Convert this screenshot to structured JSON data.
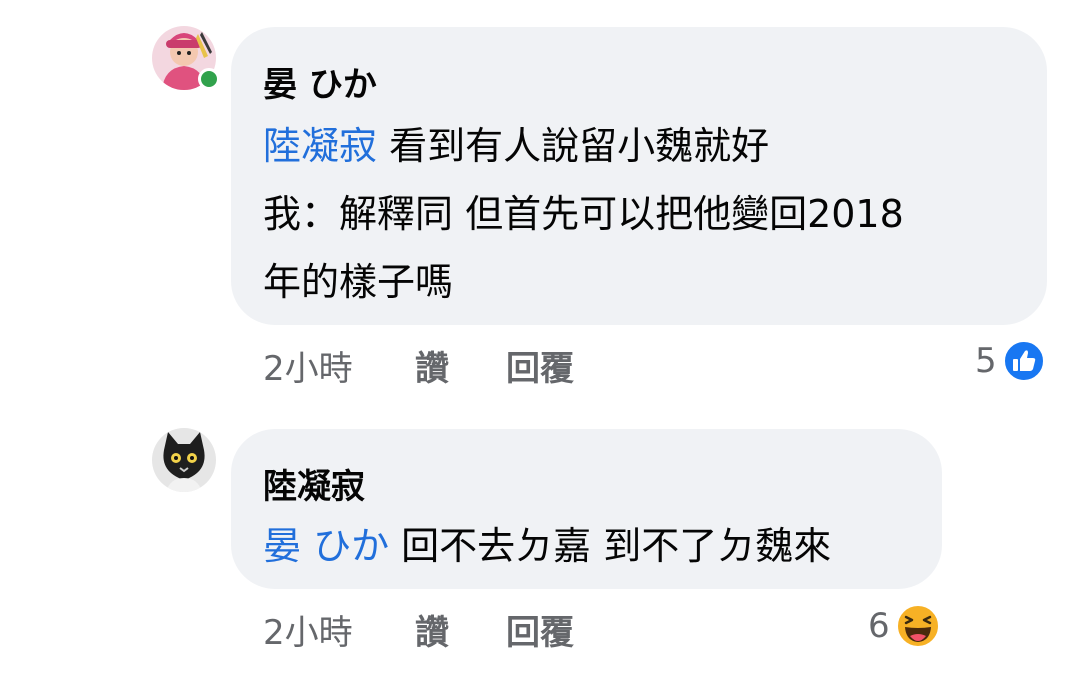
{
  "comments": [
    {
      "author": "晏 ひか",
      "mention": "陸凝寂",
      "line1_rest": " 看到有人說留小魏就好",
      "line2": "我：解釋同 但首先可以把他變回2018",
      "line3": "年的樣子嗎",
      "time": "2小時",
      "like_label": "讚",
      "reply_label": "回覆",
      "reaction_count": "5",
      "reaction_type": "like-icon",
      "online": true
    },
    {
      "author": "陸凝寂",
      "mention": "晏 ひか",
      "line1_rest": " 回不去ㄉ嘉 到不了ㄉ魏來",
      "time": "2小時",
      "like_label": "讚",
      "reply_label": "回覆",
      "reaction_count": "6",
      "reaction_type": "haha-icon"
    }
  ],
  "colors": {
    "bubble": "#f0f2f5",
    "mention": "#216fdb",
    "meta": "#65676b",
    "like_blue": "#1877f2",
    "haha_yellow": "#f7b125",
    "online_green": "#31a24c"
  }
}
